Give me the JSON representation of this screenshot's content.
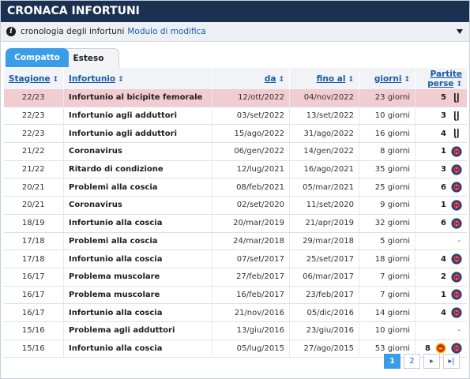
{
  "title": "CRONACA INFORTUNI",
  "info": {
    "text": "cronologia degli infortuni",
    "link": "Modulo di modifica"
  },
  "tabs": [
    {
      "label": "Compatto",
      "active": true
    },
    {
      "label": "Esteso",
      "active": false
    }
  ],
  "columns": {
    "season": "Stagione",
    "injury": "Infortunio",
    "from": "da",
    "to": "fino al",
    "days": "giorni",
    "games": "Partite perse"
  },
  "sort_arrow": "↕",
  "rows": [
    {
      "season": "22/23",
      "injury": "Infortunio al bicipite femorale",
      "from": "12/ott/2022",
      "to": "04/nov/2022",
      "days": "23 giorni",
      "games": "5",
      "clubs": [
        "juventus"
      ],
      "highlight": true
    },
    {
      "season": "22/23",
      "injury": "Infortunio agli adduttori",
      "from": "03/set/2022",
      "to": "13/set/2022",
      "days": "10 giorni",
      "games": "3",
      "clubs": [
        "juventus"
      ]
    },
    {
      "season": "22/23",
      "injury": "Infortunio agli adduttori",
      "from": "15/ago/2022",
      "to": "31/ago/2022",
      "days": "16 giorni",
      "games": "4",
      "clubs": [
        "juventus"
      ]
    },
    {
      "season": "21/22",
      "injury": "Coronavirus",
      "from": "06/gen/2022",
      "to": "14/gen/2022",
      "days": "8 giorni",
      "games": "1",
      "clubs": [
        "psg"
      ]
    },
    {
      "season": "21/22",
      "injury": "Ritardo di condizione",
      "from": "12/lug/2021",
      "to": "16/ago/2021",
      "days": "35 giorni",
      "games": "3",
      "clubs": [
        "psg"
      ]
    },
    {
      "season": "20/21",
      "injury": "Problemi alla coscia",
      "from": "08/feb/2021",
      "to": "05/mar/2021",
      "days": "25 giorni",
      "games": "6",
      "clubs": [
        "psg"
      ]
    },
    {
      "season": "20/21",
      "injury": "Coronavirus",
      "from": "02/set/2020",
      "to": "11/set/2020",
      "days": "9 giorni",
      "games": "1",
      "clubs": [
        "psg"
      ]
    },
    {
      "season": "18/19",
      "injury": "Infortunio alla coscia",
      "from": "20/mar/2019",
      "to": "21/apr/2019",
      "days": "32 giorni",
      "games": "6",
      "clubs": [
        "psg"
      ]
    },
    {
      "season": "17/18",
      "injury": "Problemi alla coscia",
      "from": "24/mar/2018",
      "to": "29/mar/2018",
      "days": "5 giorni",
      "games": "-",
      "clubs": []
    },
    {
      "season": "17/18",
      "injury": "Infortunio alla coscia",
      "from": "07/set/2017",
      "to": "25/set/2017",
      "days": "18 giorni",
      "games": "4",
      "clubs": [
        "psg"
      ]
    },
    {
      "season": "16/17",
      "injury": "Problema muscolare",
      "from": "27/feb/2017",
      "to": "06/mar/2017",
      "days": "7 giorni",
      "games": "2",
      "clubs": [
        "psg"
      ]
    },
    {
      "season": "16/17",
      "injury": "Problema muscolare",
      "from": "16/feb/2017",
      "to": "23/feb/2017",
      "days": "7 giorni",
      "games": "1",
      "clubs": [
        "psg"
      ]
    },
    {
      "season": "16/17",
      "injury": "Infortunio alla coscia",
      "from": "21/nov/2016",
      "to": "05/dic/2016",
      "days": "14 giorni",
      "games": "4",
      "clubs": [
        "psg"
      ]
    },
    {
      "season": "15/16",
      "injury": "Problema agli adduttori",
      "from": "13/giu/2016",
      "to": "23/giu/2016",
      "days": "10 giorni",
      "games": "-",
      "clubs": []
    },
    {
      "season": "15/16",
      "injury": "Infortunio alla coscia",
      "from": "05/lug/2015",
      "to": "27/ago/2015",
      "days": "53 giorni",
      "games": "8",
      "clubs": [
        "man-utd",
        "psg"
      ]
    }
  ],
  "pagination": {
    "pages": [
      "1",
      "2"
    ],
    "current": "1",
    "next": "▸",
    "last": "▸|"
  }
}
